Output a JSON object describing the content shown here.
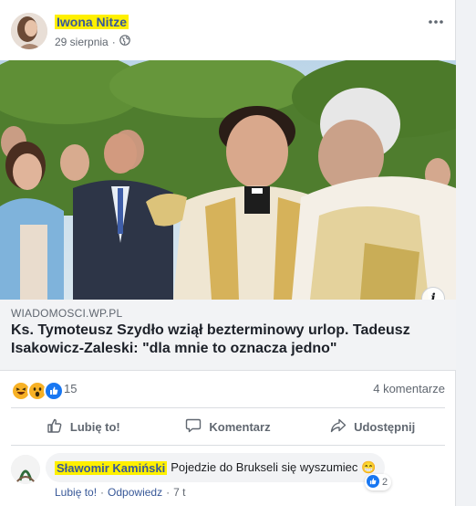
{
  "post": {
    "author": "Iwona Nitze",
    "date": "29 sierpnia",
    "separator": "·",
    "privacy_icon": "globe-icon",
    "more_icon": "more-dots-icon"
  },
  "link": {
    "domain": "WIADOMOSCI.WP.PL",
    "headline": "Ks. Tymoteusz Szydło wziął bezterminowy urlop. Tadeusz Isakowicz-Zaleski: \"dla mnie to oznacza jedno\"",
    "info_label": "i"
  },
  "reactions": {
    "icons": [
      "haha-icon",
      "wow-icon",
      "like-icon"
    ],
    "count": "15",
    "comments": "4 komentarze"
  },
  "actions": [
    {
      "label": "Lubię to!",
      "icon": "like-outline-icon"
    },
    {
      "label": "Komentarz",
      "icon": "comment-outline-icon"
    },
    {
      "label": "Udostępnij",
      "icon": "share-outline-icon"
    }
  ],
  "comment": {
    "author": "Sławomir Kamiński",
    "text": "Pojedzie do Brukseli się wyszumiec 😁",
    "likes": "2",
    "like_label": "Lubię to!",
    "reply_label": "Odpowiedz",
    "separator": "·",
    "time": "7 t"
  },
  "colors": {
    "link_blue": "#385898",
    "facebook_blue": "#1877f2",
    "highlight": "#fff000",
    "muted": "#606770"
  }
}
